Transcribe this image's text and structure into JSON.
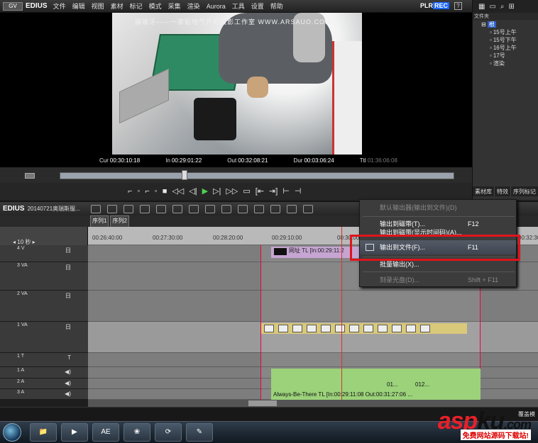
{
  "app": {
    "logo": "GV",
    "name": "EDIUS",
    "plr_label": "PLR",
    "rec_label": "REC"
  },
  "menu": [
    "文件",
    "编辑",
    "视图",
    "素材",
    "标记",
    "模式",
    "采集",
    "渲染",
    "Aurora",
    "工具",
    "设置",
    "帮助"
  ],
  "window_buttons": [
    "?",
    "▢",
    "×"
  ],
  "preview": {
    "watermark": "摄端牙——一家贴地气开的摄影工作室 WWW.ARSAUO.COM/CN",
    "cur_label": "Cur",
    "cur": "00:30:10:18",
    "in_label": "In",
    "in": "00:29:01:22",
    "out_label": "Out",
    "out": "00:32:08:21",
    "dur_label": "Dur",
    "dur": "00:03:06:24",
    "ttl_label": "Ttl",
    "ttl": "01:36:06:08"
  },
  "transport": [
    "⌐",
    "◦",
    "⌐",
    "◦",
    "■",
    "◁◁",
    "◁|",
    "▶",
    "▷|",
    "▷▷",
    "▭",
    "[⇤",
    "⇥]",
    "⊢",
    "⊣"
  ],
  "bin": {
    "title": "文件夹",
    "root": "根",
    "items": [
      "15号上午",
      "15号下午",
      "16号上午",
      "17号",
      "渲染"
    ],
    "tabs": [
      "素材库",
      "特效",
      "序列标记"
    ]
  },
  "timeline": {
    "logo": "EDIUS",
    "project": "20140721奥瑞斯服...",
    "seq_tabs": [
      "序列1",
      "序列2"
    ],
    "scale": "10 秒",
    "ruler": [
      "00:26:40:00",
      "00:27:30:00",
      "00:28:20:00",
      "00:29:10:00",
      "00:30:00:00",
      "00:32:30:00"
    ],
    "tracks": [
      {
        "label": "4 V",
        "icon": "日"
      },
      {
        "label": "3 VA",
        "icon": "日"
      },
      {
        "label": "2 VA",
        "icon": "日"
      },
      {
        "label": "1 VA",
        "icon": "日"
      },
      {
        "label": "1 T",
        "icon": "T"
      },
      {
        "label": "1 A",
        "icon": "◀)"
      },
      {
        "label": "2 A",
        "icon": "◀)"
      },
      {
        "label": "3 A",
        "icon": "◀)"
      }
    ],
    "clip_v_label": "网址  TL [In:00:29:11:2",
    "clip_a_label": "Always-Be-There  TL [In:00:29:11:08 Out:00:31:27:06 ...",
    "clip_a_mid": "01...",
    "clip_a_right": "012...",
    "status_right": "覆盖模"
  },
  "context_menu": {
    "items": [
      {
        "label": "默认输出器(输出到文件)(D)",
        "shortcut": "",
        "disabled": true
      },
      {
        "label": "输出到磁带(T)...",
        "shortcut": "F12",
        "disabled": false
      },
      {
        "label": "输出到磁带(显示时间码)(A)...",
        "shortcut": "",
        "disabled": false
      },
      {
        "label": "输出到文件(F)...",
        "shortcut": "F11",
        "disabled": false,
        "selected": true
      },
      {
        "label": "批量输出(X)...",
        "shortcut": "",
        "disabled": false
      },
      {
        "label": "刻录光盘(D)...",
        "shortcut": "Shift + F11",
        "disabled": true
      }
    ]
  },
  "taskbar": {
    "apps": [
      "📁",
      "▶",
      "AE",
      "❀",
      "⟳",
      "✎"
    ]
  },
  "brand": {
    "main_red": "asp",
    "main_black": "ku",
    "tld": ".com",
    "sub": "免费网站源码下载站!"
  },
  "colors": {
    "highlight_red": "#e0141c",
    "selection_blue": "#2a5fc9",
    "rec_blue": "#1a66ff"
  }
}
